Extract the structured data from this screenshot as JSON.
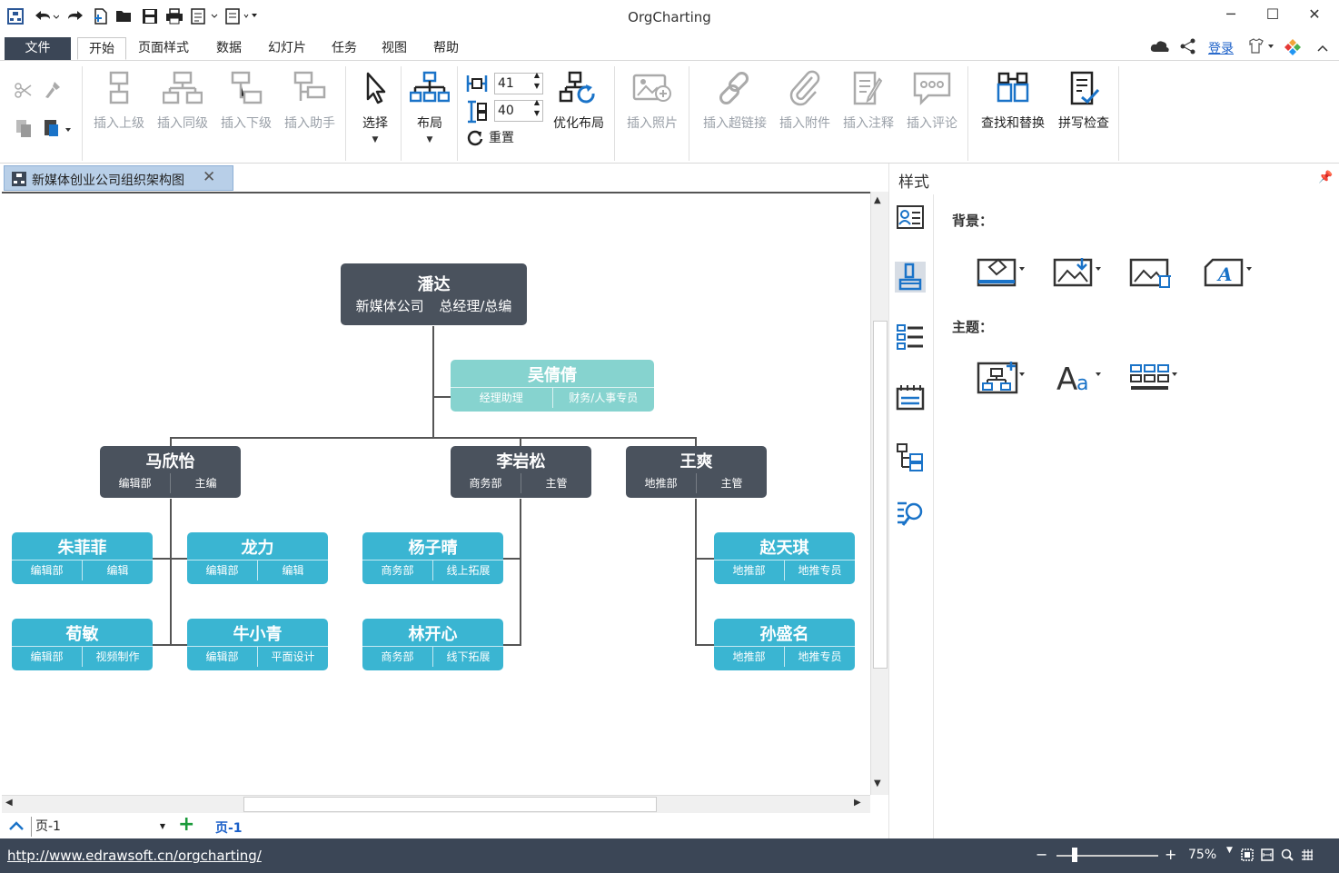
{
  "app": {
    "title": "OrgCharting"
  },
  "menu": {
    "file": "文件",
    "tabs": [
      "开始",
      "页面样式",
      "数据",
      "幻灯片",
      "任务",
      "视图",
      "帮助"
    ],
    "login": "登录"
  },
  "ribbon": {
    "insert_superior": "插入上级",
    "insert_peer": "插入同级",
    "insert_subordinate": "插入下级",
    "insert_assistant": "插入助手",
    "select": "选择",
    "layout": "布局",
    "spacing_h": "41",
    "spacing_v": "40",
    "reset": "重置",
    "optimize_layout": "优化布局",
    "insert_photo": "插入照片",
    "insert_hyperlink": "插入超链接",
    "insert_attachment": "插入附件",
    "insert_note": "插入注释",
    "insert_comment": "插入评论",
    "find_replace": "查找和替换",
    "spell_check": "拼写检查"
  },
  "document": {
    "tab_name": "新媒体创业公司组织架构图"
  },
  "org": {
    "root": {
      "name": "潘达",
      "company": "新媒体公司",
      "title": "总经理/总编"
    },
    "assistant": {
      "name": "吴倩倩",
      "dept": "经理助理",
      "title": "财务/人事专员"
    },
    "managers": [
      {
        "name": "马欣怡",
        "dept": "编辑部",
        "title": "主编"
      },
      {
        "name": "李岩松",
        "dept": "商务部",
        "title": "主管"
      },
      {
        "name": "王爽",
        "dept": "地推部",
        "title": "主管"
      }
    ],
    "staff": [
      {
        "name": "朱菲菲",
        "dept": "编辑部",
        "title": "编辑"
      },
      {
        "name": "龙力",
        "dept": "编辑部",
        "title": "编辑"
      },
      {
        "name": "荀敏",
        "dept": "编辑部",
        "title": "视频制作"
      },
      {
        "name": "牛小青",
        "dept": "编辑部",
        "title": "平面设计"
      },
      {
        "name": "杨子晴",
        "dept": "商务部",
        "title": "线上拓展"
      },
      {
        "name": "林开心",
        "dept": "商务部",
        "title": "线下拓展"
      },
      {
        "name": "赵天琪",
        "dept": "地推部",
        "title": "地推专员"
      },
      {
        "name": "孙盛名",
        "dept": "地推部",
        "title": "地推专员"
      }
    ]
  },
  "pages": {
    "selector": "页-1",
    "active_tab": "页-1"
  },
  "side_panel": {
    "title": "样式",
    "background_label": "背景：",
    "theme_label": "主题："
  },
  "status": {
    "url": "http://www.edrawsoft.cn/orgcharting/",
    "zoom": "75%"
  },
  "colors": {
    "dark_node": "#4a525d",
    "assistant_node": "#86d3cf",
    "staff_node": "#3ab5d2",
    "accent": "#3b4656"
  }
}
